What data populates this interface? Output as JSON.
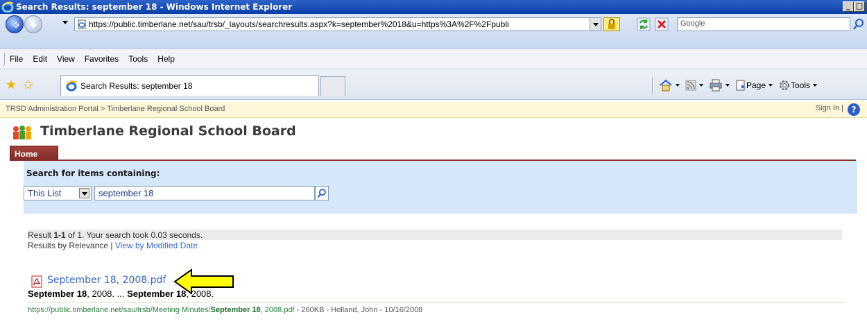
{
  "window": {
    "title": "Search Results: september 18 - Windows Internet Explorer",
    "buttons": [
      "_",
      "□"
    ]
  },
  "address_bar": {
    "url": "https://public.timberlane.net/sau/trsb/_layouts/searchresults.aspx?k=september%2018&u=https%3A%2F%2Fpubli",
    "search_placeholder": "Google"
  },
  "menu": {
    "items": [
      "File",
      "Edit",
      "View",
      "Favorites",
      "Tools",
      "Help"
    ]
  },
  "tabs": {
    "active_label": "Search Results: september 18"
  },
  "command_bar": {
    "page_label": "Page",
    "tools_label": "Tools"
  },
  "sharepoint": {
    "breadcrumb": "TRSD Administration Portal > Timberlane Regional School Board",
    "sign_in": "Sign In |",
    "help": "?",
    "site_title": "Timberlane Regional School Board",
    "home_tab": "Home",
    "search_label": "Search for items containing:",
    "scope_value": "This List",
    "query_value": "september 18"
  },
  "results": {
    "summary_prefix": "Result ",
    "summary_range": "1-1",
    "summary_suffix": " of 1. Your search took 0.03 seconds.",
    "sort_current": "Results by Relevance",
    "sort_sep": " | ",
    "sort_link": "View by Modified Date",
    "items": [
      {
        "title": "September 18, 2008.pdf",
        "snippet_b1": "September 18",
        "snippet_t1": ", 2008. ... ",
        "snippet_b2": "September 18",
        "snippet_t2": ", 2008.",
        "url_pre": "https://public.timberlane.net/sau/trsb/Meeting Minutes/",
        "url_b": "September 18",
        "url_post": ", 2008.pdf",
        "meta": " - 260KB - Holland, John - 10/16/2008"
      }
    ]
  },
  "colors": {
    "link": "#3366cc",
    "url_green": "#287d3c",
    "search_panel": "#d6e7fa",
    "home_tab": "#8b2f28",
    "arrow": "#ffff00"
  }
}
